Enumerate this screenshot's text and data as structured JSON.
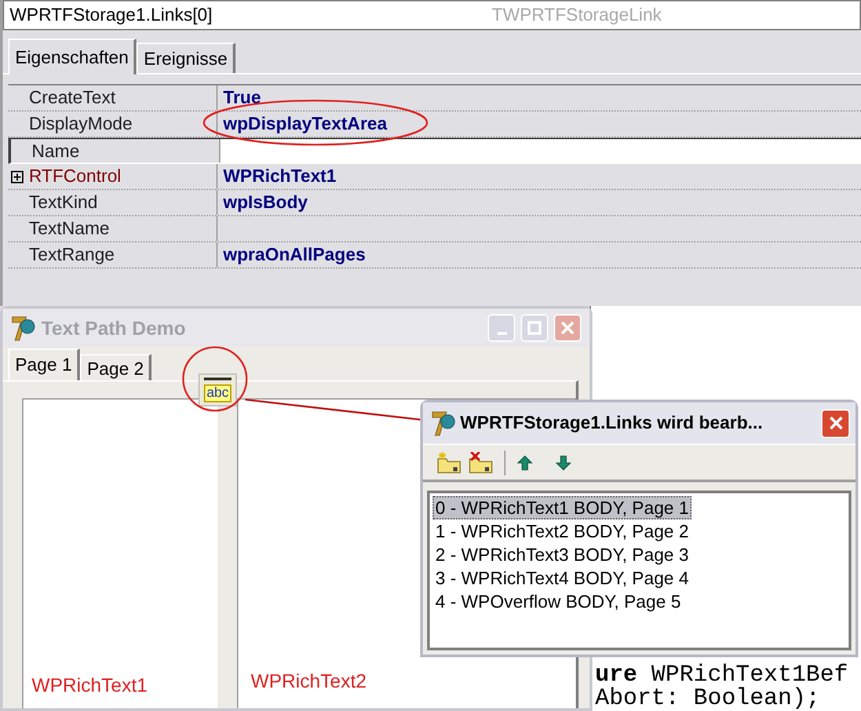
{
  "inspector": {
    "object": "WPRTFStorage1.Links[0]",
    "class": "TWPRTFStorageLink",
    "tabs": [
      {
        "label": "Eigenschaften",
        "selected": true
      },
      {
        "label": "Ereignisse",
        "selected": false
      }
    ],
    "properties": [
      {
        "name": "CreateText",
        "value": "True",
        "selected": false,
        "expandable": false
      },
      {
        "name": "DisplayMode",
        "value": "wpDisplayTextArea",
        "selected": false,
        "expandable": false
      },
      {
        "name": "Name",
        "selected": true,
        "expandable": false
      },
      {
        "name": "RTFControl",
        "value": "WPRichText1",
        "selected": false,
        "expandable": true
      },
      {
        "name": "TextKind",
        "value": "wpIsBody",
        "selected": false,
        "expandable": false
      },
      {
        "name": "TextName",
        "selected": false,
        "expandable": false
      },
      {
        "name": "TextRange",
        "value": "wpraOnAllPages",
        "selected": false,
        "expandable": false
      }
    ]
  },
  "demo_window": {
    "title": "Text Path Demo",
    "tabs": [
      {
        "label": "Page 1",
        "selected": true
      },
      {
        "label": "Page 2",
        "selected": false
      }
    ],
    "component_icon": "abc",
    "panels": [
      "WPRichText1",
      "WPRichText2"
    ]
  },
  "dialog": {
    "title": "WPRTFStorage1.Links wird bearb...",
    "items": [
      {
        "label": "0 - WPRichText1 BODY, Page 1",
        "selected": true
      },
      {
        "label": "1 - WPRichText2 BODY, Page 2",
        "selected": false
      },
      {
        "label": "2 - WPRichText3 BODY, Page 3",
        "selected": false
      },
      {
        "label": "3 - WPRichText4 BODY, Page 4",
        "selected": false
      },
      {
        "label": "4 - WPOverflow BODY, Page 5",
        "selected": false
      }
    ]
  },
  "code": [
    "**ure** WPRichText1Bef",
    "Abort: Boolean);"
  ]
}
